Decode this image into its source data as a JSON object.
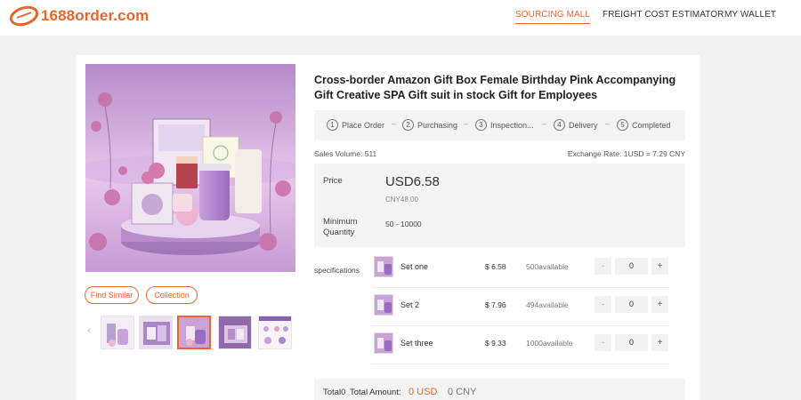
{
  "brand": {
    "name": "1688order.com",
    "accent": "#e8662e"
  },
  "nav": {
    "items": [
      {
        "label": "SOURCING MALL",
        "active": true
      },
      {
        "label": "FREIGHT COST ESTIMATOR",
        "active": false
      },
      {
        "label": "MY WALLET",
        "active": false
      }
    ]
  },
  "product": {
    "title": "Cross-border Amazon Gift Box Female Birthday Pink Accompanying Gift Creative SPA Gift suit in stock Gift for Employees",
    "find_similar_label": "Find Similar",
    "collection_label": "Collection",
    "thumbnails_selected_index": 2
  },
  "steps": [
    {
      "num": "1",
      "label": "Place Order"
    },
    {
      "num": "2",
      "label": "Purchasing"
    },
    {
      "num": "3",
      "label": "Inspection..."
    },
    {
      "num": "4",
      "label": "Delivery"
    },
    {
      "num": "5",
      "label": "Completed"
    }
  ],
  "step_separator": "–",
  "meta": {
    "sales_label": "Sales Volume:",
    "sales_value": "511",
    "exchange_label": "Exchange Rate:",
    "exchange_value": "1USD = 7.29 CNY"
  },
  "price": {
    "label": "Price",
    "usd": "USD6.58",
    "cny": "CNY48.00",
    "min_qty_label_line1": "Minimum",
    "min_qty_label_line2": "Quantity",
    "min_qty_range": "50 - 10000"
  },
  "specs": {
    "label": "specifications",
    "rows": [
      {
        "name": "Set one",
        "price": "$ 6.58",
        "available": "500available",
        "qty": "0",
        "minus": "-",
        "plus": "+"
      },
      {
        "name": "Set 2",
        "price": "$ 7.96",
        "available": "494available",
        "qty": "0",
        "minus": "-",
        "plus": "+"
      },
      {
        "name": "Set three",
        "price": "$ 9.33",
        "available": "1000available",
        "qty": "0",
        "minus": "-",
        "plus": "+"
      }
    ]
  },
  "total": {
    "count_label": "Total0",
    "amount_label": "Total Amount:",
    "usd": "0 USD",
    "cny": "0 CNY"
  },
  "icons": {
    "logo": "1688order-swoosh-icon",
    "thumb_prev": "chevron-left-icon"
  },
  "thumb_prev_glyph": "‹"
}
